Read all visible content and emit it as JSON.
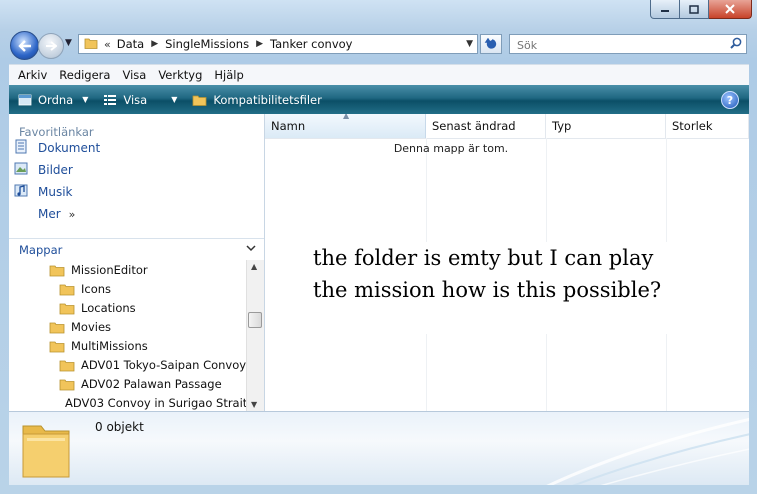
{
  "window": {
    "caption_buttons": [
      "minimize",
      "maximize",
      "close"
    ]
  },
  "address": {
    "root_chevron": "«",
    "breadcrumbs": [
      "Data",
      "SingleMissions",
      "Tanker convoy"
    ]
  },
  "search": {
    "placeholder": "Sök"
  },
  "menu": [
    "Arkiv",
    "Redigera",
    "Visa",
    "Verktyg",
    "Hjälp"
  ],
  "commandbar": {
    "organize": "Ordna",
    "views": "Visa",
    "compat": "Kompatibilitetsfiler",
    "help": "?"
  },
  "favorites": {
    "header": "Favoritlänkar",
    "items": [
      "Dokument",
      "Bilder",
      "Musik"
    ],
    "more": "Mer"
  },
  "folders": {
    "header": "Mappar",
    "items": [
      {
        "label": "MissionEditor",
        "indent": 1
      },
      {
        "label": "Icons",
        "indent": 2
      },
      {
        "label": "Locations",
        "indent": 2
      },
      {
        "label": "Movies",
        "indent": 1
      },
      {
        "label": "MultiMissions",
        "indent": 1
      },
      {
        "label": "ADV01 Tokyo-Saipan Convoy",
        "indent": 2
      },
      {
        "label": "ADV02 Palawan Passage",
        "indent": 2
      },
      {
        "label": "ADV03 Convoy in Surigao Strait",
        "indent": 2
      }
    ]
  },
  "filelist": {
    "columns": [
      "Namn",
      "Senast ändrad",
      "Typ",
      "Storlek"
    ],
    "empty_message": "Denna mapp är tom."
  },
  "annotation": {
    "line1": "the folder is emty but I can play",
    "line2": "the mission how is this possible?"
  },
  "details": {
    "count": "0 objekt"
  },
  "colors": {
    "window_frame": "#b9d3e8",
    "commandbar": "#1f6781",
    "link_blue": "#1f4e9a",
    "folder_yellow": "#f1c45a"
  }
}
